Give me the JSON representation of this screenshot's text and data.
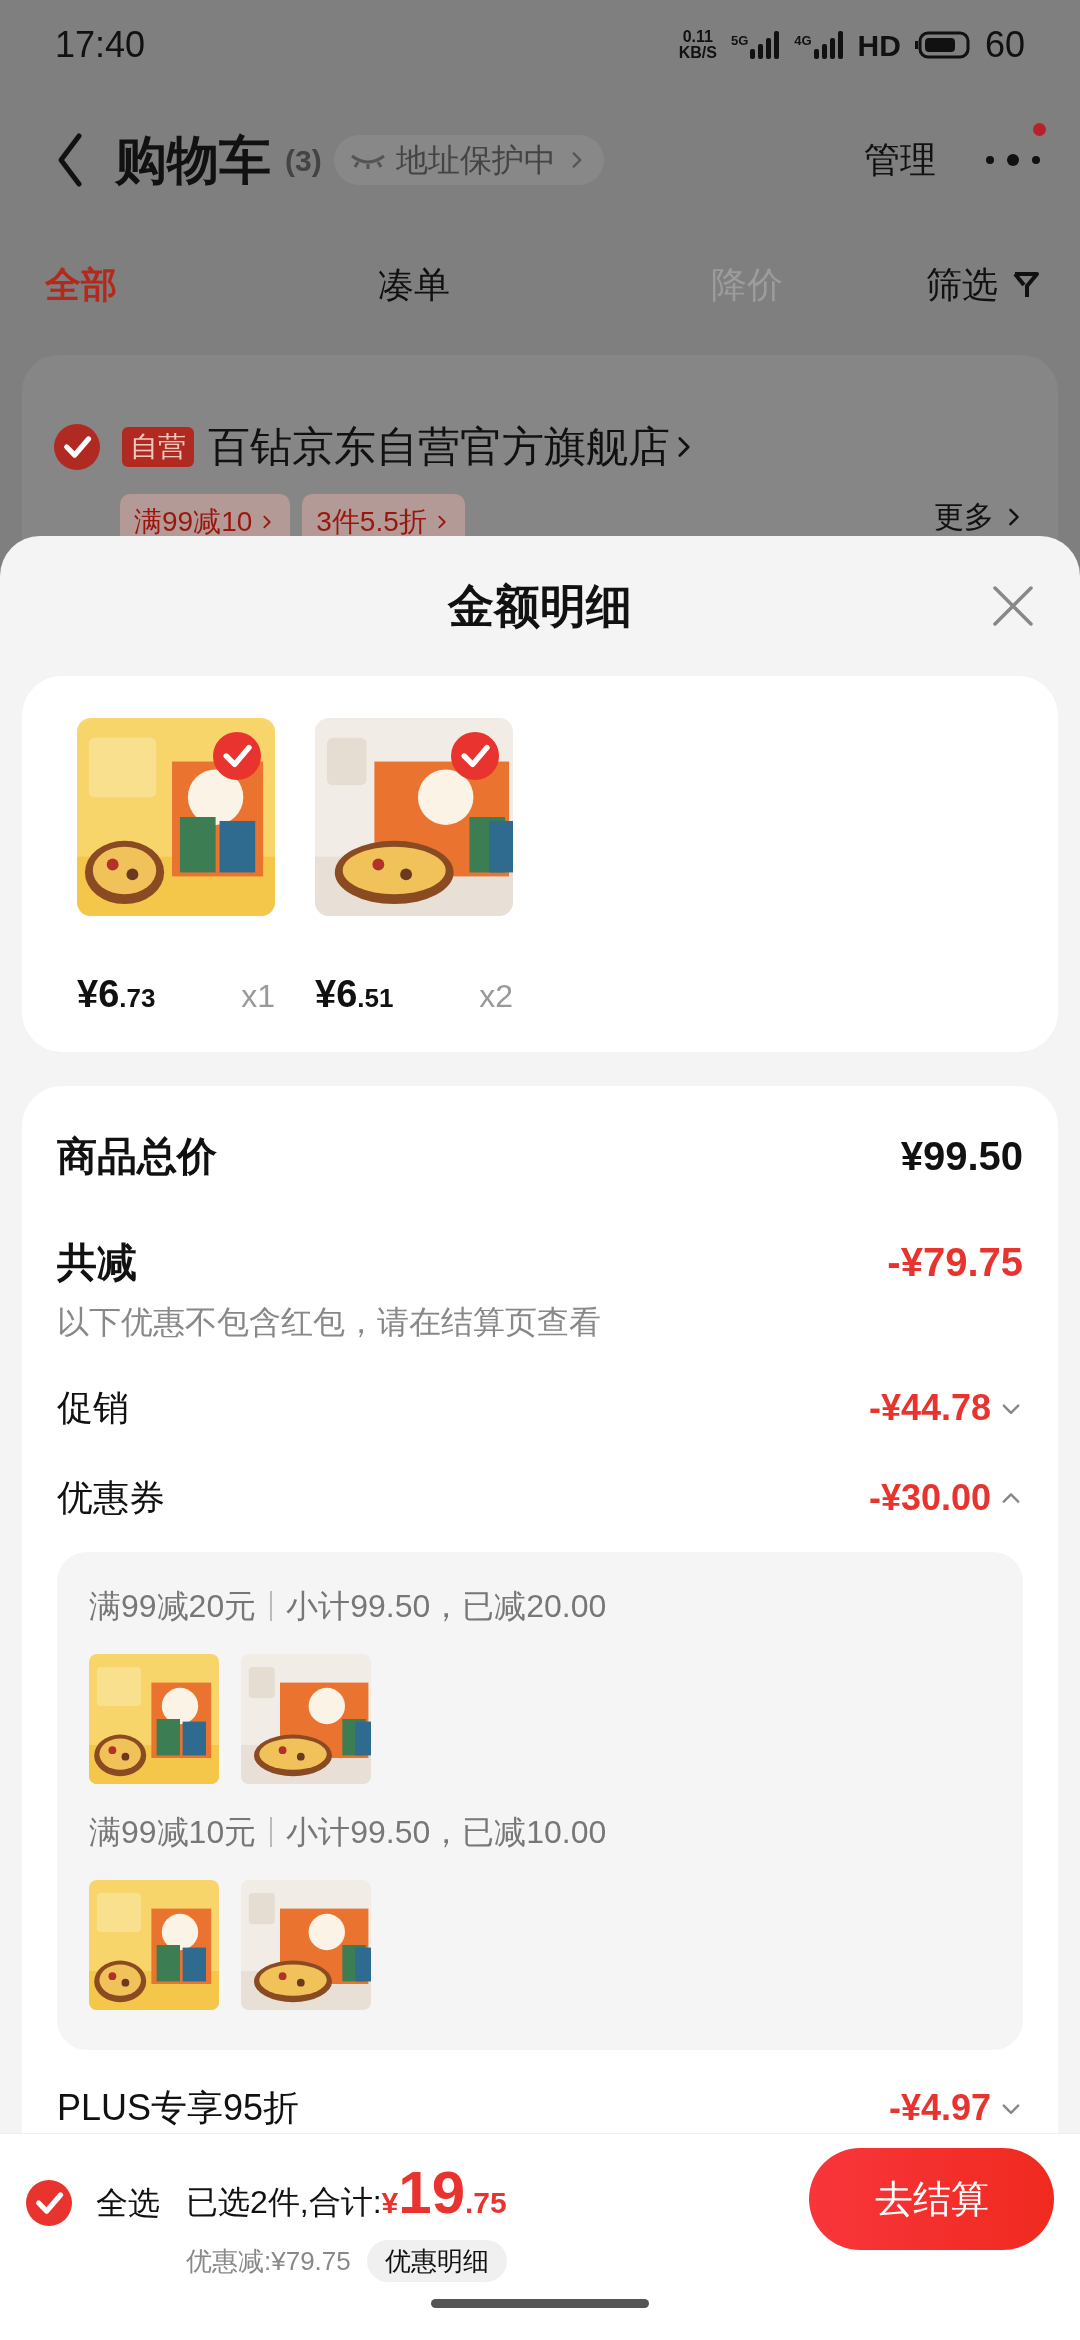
{
  "status_bar": {
    "time": "17:40",
    "net_speed": "0.11",
    "net_unit": "KB/S",
    "sim_1": "5G",
    "sim_2": "4G",
    "hd": "HD",
    "battery": "60"
  },
  "header": {
    "title": "购物车",
    "count": "(3)",
    "address_chip": "地址保护中",
    "manage": "管理",
    "has_notification": true
  },
  "tabs": [
    {
      "label": "全部",
      "selected": true,
      "disabled": false
    },
    {
      "label": "凑单",
      "selected": false,
      "disabled": false
    },
    {
      "label": "降价",
      "selected": false,
      "disabled": true
    }
  ],
  "filter": "筛选",
  "store": {
    "checked": true,
    "badge": "自营",
    "name": "百钻京东自营官方旗舰店",
    "promos": [
      "满99减10",
      "3件5.5折"
    ],
    "more": "更多"
  },
  "sheet": {
    "title": "金额明细",
    "items": [
      {
        "kind": "picture",
        "selected": true,
        "price_whole": "¥6",
        "price_fraction": ".73",
        "quantity": "x1"
      },
      {
        "kind": "picture",
        "selected": true,
        "price_whole": "¥6",
        "price_fraction": ".51",
        "quantity": "x2"
      }
    ],
    "goods_total": {
      "label": "商品总价",
      "amount": "¥99.50"
    },
    "total_discount": {
      "label": "共减",
      "amount": "-¥79.75",
      "note": "以下优惠不包含红包，请在结算页查看"
    },
    "discounts": [
      {
        "label": "促销",
        "amount": "-¥44.78",
        "expanded": false
      },
      {
        "label": "优惠券",
        "amount": "-¥30.00",
        "expanded": true,
        "coupons": [
          {
            "title": "满99减20元",
            "detail": "小计99.50，已减20.00"
          },
          {
            "title": "满99减10元",
            "detail": "小计99.50，已减10.00"
          }
        ]
      },
      {
        "label": "PLUS专享95折",
        "amount": "-¥4.97",
        "expanded": false
      }
    ]
  },
  "bottom_bar": {
    "select_all_checked": true,
    "select_all": "全选",
    "summary": "已选2件,合计:",
    "currency": "¥",
    "total_whole": "19",
    "total_fraction": ".75",
    "discount": "优惠减:¥79.75",
    "detail_button": "优惠明细",
    "checkout": "去结算"
  }
}
